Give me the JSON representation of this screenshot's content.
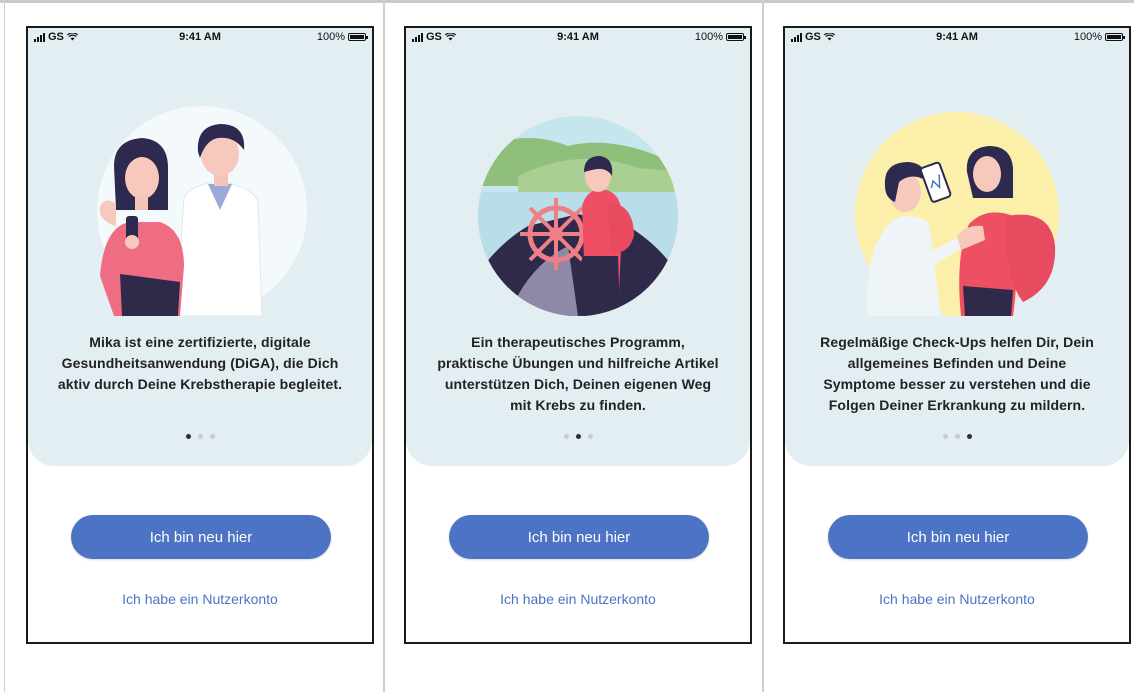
{
  "status_bar": {
    "carrier": "GS",
    "time": "9:41 AM",
    "battery": "100%"
  },
  "colors": {
    "primary": "#4c73c4",
    "card_background": "#e3eef3"
  },
  "screens": [
    {
      "illustration": "doctor-and-patient-illustration",
      "text": [
        "Mika ist eine zertifizierte, digitale",
        "Gesundheitsanwendung (DiGA), die Dich",
        "aktiv durch Deine Krebstherapie begleitet."
      ],
      "active_page": 1,
      "primary_button": "Ich bin neu hier",
      "secondary_link": "Ich habe ein Nutzerkonto"
    },
    {
      "illustration": "person-steering-boat-illustration",
      "text": [
        "Ein therapeutisches Programm,",
        "praktische Übungen und hilfreiche Artikel",
        "unterstützen Dich, Deinen eigenen Weg",
        "mit Krebs zu finden."
      ],
      "active_page": 2,
      "primary_button": "Ich bin neu hier",
      "secondary_link": "Ich habe ein Nutzerkonto"
    },
    {
      "illustration": "doctor-consultation-phone-illustration",
      "text": [
        "Regelmäßige Check-Ups helfen Dir, Dein",
        "allgemeines Befinden und Deine",
        "Symptome besser zu verstehen und die",
        "Folgen Deiner Erkrankung zu mildern."
      ],
      "active_page": 3,
      "primary_button": "Ich bin neu hier",
      "secondary_link": "Ich habe ein Nutzerkonto"
    }
  ],
  "page_count": 3
}
